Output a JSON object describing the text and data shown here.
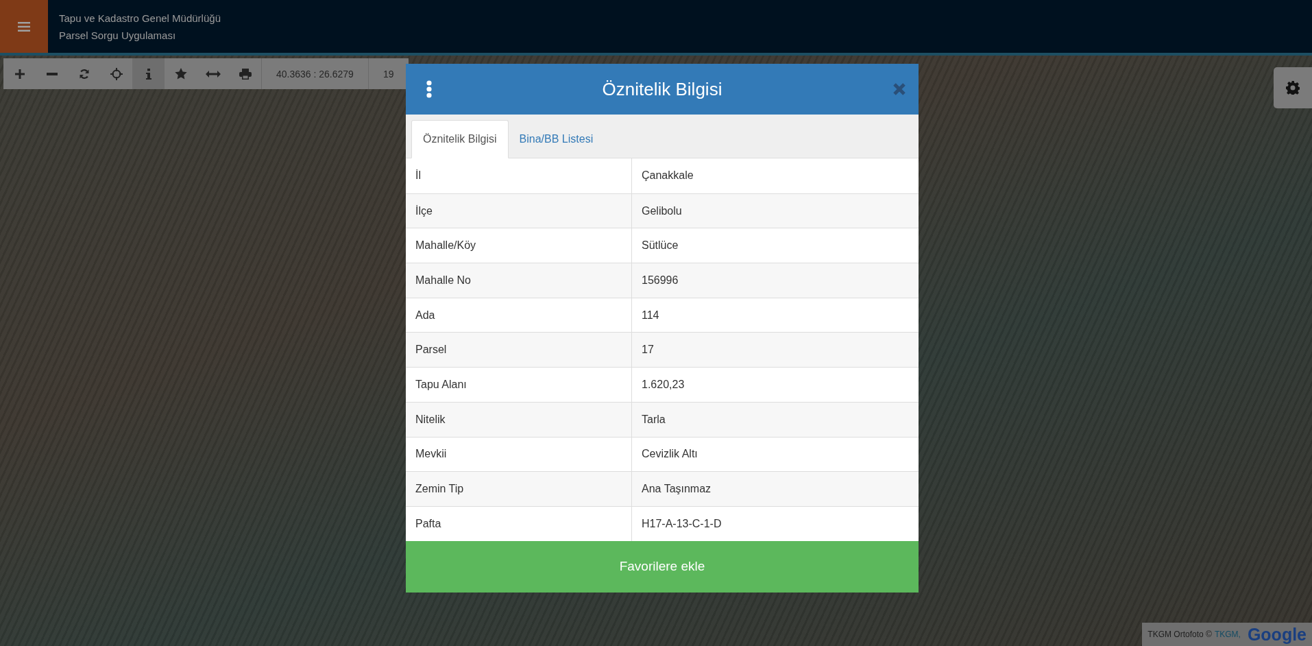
{
  "header": {
    "title": "Tapu ve Kadastro Genel Müdürlüğü",
    "subtitle": "Parsel Sorgu Uygulaması"
  },
  "toolbar": {
    "tools": [
      {
        "selected": false
      },
      {
        "selected": false
      },
      {
        "selected": false
      },
      {
        "selected": false
      },
      {
        "selected": true
      },
      {
        "selected": false
      },
      {
        "selected": false
      },
      {
        "selected": false
      }
    ],
    "coordinates": "40.3636 : 26.6279",
    "zoom": "19"
  },
  "modal": {
    "title": "Öznitelik Bilgisi",
    "tabs": [
      {
        "label": "Öznitelik Bilgisi",
        "selected": true
      },
      {
        "label": "Bina/BB Listesi",
        "selected": false
      }
    ],
    "rows": [
      {
        "label": "İl",
        "value": "Çanakkale"
      },
      {
        "label": "İlçe",
        "value": "Gelibolu"
      },
      {
        "label": "Mahalle/Köy",
        "value": "Sütlüce"
      },
      {
        "label": "Mahalle No",
        "value": "156996"
      },
      {
        "label": "Ada",
        "value": "114"
      },
      {
        "label": "Parsel",
        "value": "17"
      },
      {
        "label": "Tapu Alanı",
        "value": "1.620,23"
      },
      {
        "label": "Nitelik",
        "value": "Tarla"
      },
      {
        "label": "Mevkii",
        "value": "Cevizlik Altı"
      },
      {
        "label": "Zemin Tip",
        "value": "Ana Taşınmaz"
      },
      {
        "label": "Pafta",
        "value": "H17-A-13-C-1-D"
      }
    ],
    "button": "Favorilere ekle"
  },
  "attribution": {
    "text": "TKGM Ortofoto ©",
    "link": "TKGM,",
    "logo": "Google"
  }
}
